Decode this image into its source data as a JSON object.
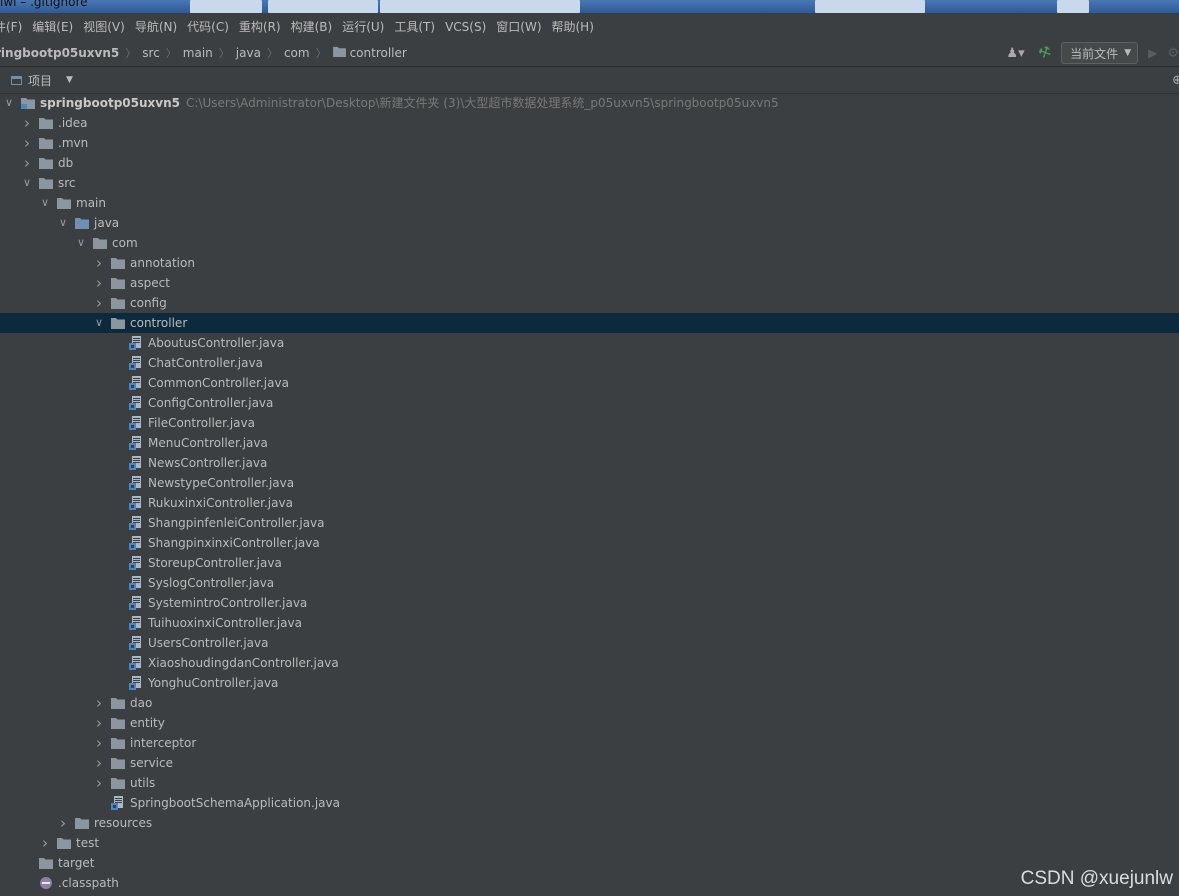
{
  "window": {
    "title_fragment": "lwl – .gitignore"
  },
  "menubar": {
    "items": [
      "件(F)",
      "编辑(E)",
      "视图(V)",
      "导航(N)",
      "代码(C)",
      "重构(R)",
      "构建(B)",
      "运行(U)",
      "工具(T)",
      "VCS(S)",
      "窗口(W)",
      "帮助(H)"
    ]
  },
  "breadcrumb": {
    "items": [
      "ringbootp05uxvn5",
      "src",
      "main",
      "java",
      "com",
      "controller"
    ]
  },
  "toolbar": {
    "run_config_label": "当前文件",
    "icons": [
      "user-icon",
      "hammer-icon",
      "run-icon",
      "debug-icon"
    ]
  },
  "project_panel": {
    "label": "项目",
    "icons": [
      "project-view-icon",
      "globe-icon"
    ]
  },
  "tree": {
    "root": {
      "name": "springbootp05uxvn5",
      "path": "C:\\Users\\Administrator\\Desktop\\新建文件夹 (3)\\大型超市数据处理系统_p05uxvn5\\springbootp05uxvn5"
    },
    "rows": [
      {
        "name": ".idea",
        "level": 1,
        "kind": "folder",
        "state": "collapsed"
      },
      {
        "name": ".mvn",
        "level": 1,
        "kind": "folder",
        "state": "collapsed"
      },
      {
        "name": "db",
        "level": 1,
        "kind": "folder",
        "state": "collapsed"
      },
      {
        "name": "src",
        "level": 1,
        "kind": "folder",
        "state": "expanded"
      },
      {
        "name": "main",
        "level": 2,
        "kind": "folder",
        "state": "expanded"
      },
      {
        "name": "java",
        "level": 3,
        "kind": "folder-source",
        "state": "expanded"
      },
      {
        "name": "com",
        "level": 4,
        "kind": "folder",
        "state": "expanded"
      },
      {
        "name": "annotation",
        "level": 5,
        "kind": "folder",
        "state": "collapsed"
      },
      {
        "name": "aspect",
        "level": 5,
        "kind": "folder",
        "state": "collapsed"
      },
      {
        "name": "config",
        "level": 5,
        "kind": "folder",
        "state": "collapsed"
      },
      {
        "name": "controller",
        "level": 5,
        "kind": "folder",
        "state": "expanded",
        "selected": true
      },
      {
        "name": "AboutusController.java",
        "level": 6,
        "kind": "java",
        "state": "leaf"
      },
      {
        "name": "ChatController.java",
        "level": 6,
        "kind": "java",
        "state": "leaf"
      },
      {
        "name": "CommonController.java",
        "level": 6,
        "kind": "java",
        "state": "leaf"
      },
      {
        "name": "ConfigController.java",
        "level": 6,
        "kind": "java",
        "state": "leaf"
      },
      {
        "name": "FileController.java",
        "level": 6,
        "kind": "java",
        "state": "leaf"
      },
      {
        "name": "MenuController.java",
        "level": 6,
        "kind": "java",
        "state": "leaf"
      },
      {
        "name": "NewsController.java",
        "level": 6,
        "kind": "java",
        "state": "leaf"
      },
      {
        "name": "NewstypeController.java",
        "level": 6,
        "kind": "java",
        "state": "leaf"
      },
      {
        "name": "RukuxinxiController.java",
        "level": 6,
        "kind": "java",
        "state": "leaf"
      },
      {
        "name": "ShangpinfenleiController.java",
        "level": 6,
        "kind": "java",
        "state": "leaf"
      },
      {
        "name": "ShangpinxinxiController.java",
        "level": 6,
        "kind": "java",
        "state": "leaf"
      },
      {
        "name": "StoreupController.java",
        "level": 6,
        "kind": "java",
        "state": "leaf"
      },
      {
        "name": "SyslogController.java",
        "level": 6,
        "kind": "java",
        "state": "leaf"
      },
      {
        "name": "SystemintroController.java",
        "level": 6,
        "kind": "java",
        "state": "leaf"
      },
      {
        "name": "TuihuoxinxiController.java",
        "level": 6,
        "kind": "java",
        "state": "leaf"
      },
      {
        "name": "UsersController.java",
        "level": 6,
        "kind": "java",
        "state": "leaf"
      },
      {
        "name": "XiaoshoudingdanController.java",
        "level": 6,
        "kind": "java",
        "state": "leaf"
      },
      {
        "name": "YonghuController.java",
        "level": 6,
        "kind": "java",
        "state": "leaf"
      },
      {
        "name": "dao",
        "level": 5,
        "kind": "folder",
        "state": "collapsed"
      },
      {
        "name": "entity",
        "level": 5,
        "kind": "folder",
        "state": "collapsed"
      },
      {
        "name": "interceptor",
        "level": 5,
        "kind": "folder",
        "state": "collapsed"
      },
      {
        "name": "service",
        "level": 5,
        "kind": "folder",
        "state": "collapsed"
      },
      {
        "name": "utils",
        "level": 5,
        "kind": "folder",
        "state": "collapsed"
      },
      {
        "name": "SpringbootSchemaApplication.java",
        "level": 5,
        "kind": "java",
        "state": "leaf"
      },
      {
        "name": "resources",
        "level": 3,
        "kind": "folder",
        "state": "collapsed"
      },
      {
        "name": "test",
        "level": 2,
        "kind": "folder",
        "state": "collapsed"
      },
      {
        "name": "target",
        "level": 1,
        "kind": "folder",
        "state": "leaf"
      },
      {
        "name": ".classpath",
        "level": 1,
        "kind": "classpath",
        "state": "leaf"
      }
    ]
  },
  "watermark": "CSDN @xuejunlw",
  "colors": {
    "background": "#3c3f41",
    "selection": "#0d293e",
    "text": "#bbbbbb",
    "folder": "#8c96a0",
    "java_file_accent": "#4a86c7"
  }
}
